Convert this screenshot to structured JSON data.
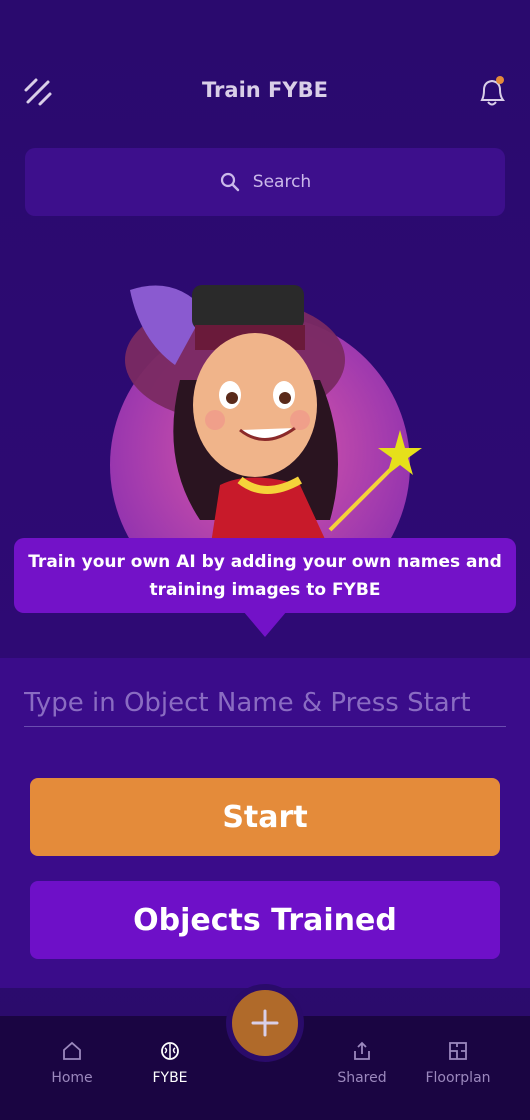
{
  "header": {
    "title": "Train FYBE"
  },
  "search": {
    "placeholder": "Search"
  },
  "hero": {
    "caption": "Train your own AI by adding your own names and training images to FYBE"
  },
  "form": {
    "name_placeholder": "Type in Object Name & Press Start",
    "start_label": "Start",
    "objects_trained_label": "Objects Trained"
  },
  "nav": {
    "home": "Home",
    "fybe": "FYBE",
    "shared": "Shared",
    "floorplan": "Floorplan"
  },
  "colors": {
    "background": "#2a0a6e",
    "accent_orange": "#e48b3a",
    "accent_purple": "#6e10c8"
  }
}
